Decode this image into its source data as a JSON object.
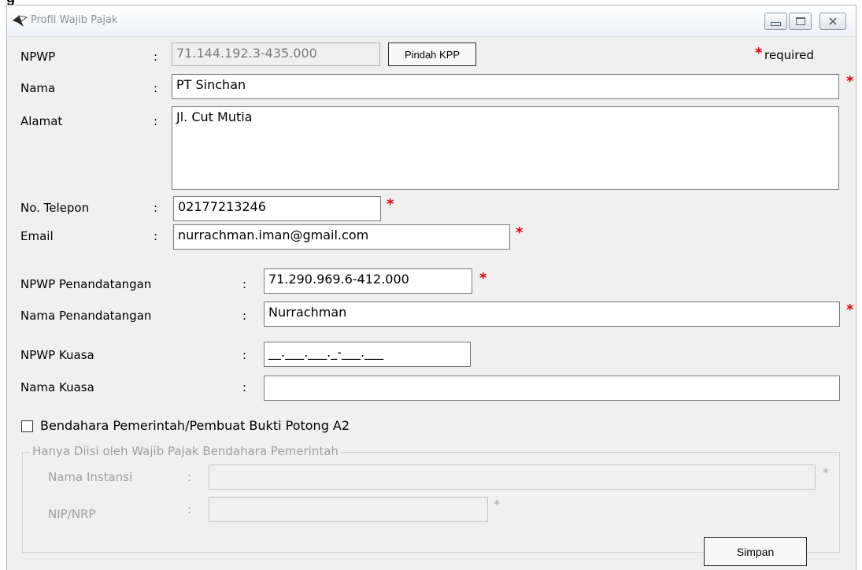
{
  "window": {
    "title": "Profil Wajib Pajak",
    "top_fragment": "g"
  },
  "required_hint": "required",
  "star": "*",
  "colon": ":",
  "npwp": {
    "label": "NPWP",
    "value": "71.144.192.3-435.000",
    "move_button": "Pindah KPP"
  },
  "nama": {
    "label": "Nama",
    "value": "PT Sinchan"
  },
  "alamat": {
    "label": "Alamat",
    "value": "Jl. Cut Mutia"
  },
  "telepon": {
    "label": "No. Telepon",
    "value": "02177213246"
  },
  "email": {
    "label": "Email",
    "value": "nurrachman.iman@gmail.com"
  },
  "npwp_penandatangan": {
    "label": "NPWP Penandatangan",
    "value": "71.290.969.6-412.000"
  },
  "nama_penandatangan": {
    "label": "Nama Penandatangan",
    "value": "Nurrachman"
  },
  "npwp_kuasa": {
    "label": "NPWP Kuasa",
    "value": "__.___.___._-___.___"
  },
  "nama_kuasa": {
    "label": "Nama Kuasa",
    "value": ""
  },
  "bendahara": {
    "label": "Bendahara Pemerintah/Pembuat Bukti Potong A2",
    "checked": false
  },
  "group": {
    "title": "Hanya Diisi oleh Wajib Pajak Bendahara Pemerintah",
    "nama_instansi": {
      "label": "Nama Instansi",
      "value": ""
    },
    "nip_nrp": {
      "label": "NIP/NRP",
      "value": ""
    }
  },
  "save_button": "Simpan"
}
